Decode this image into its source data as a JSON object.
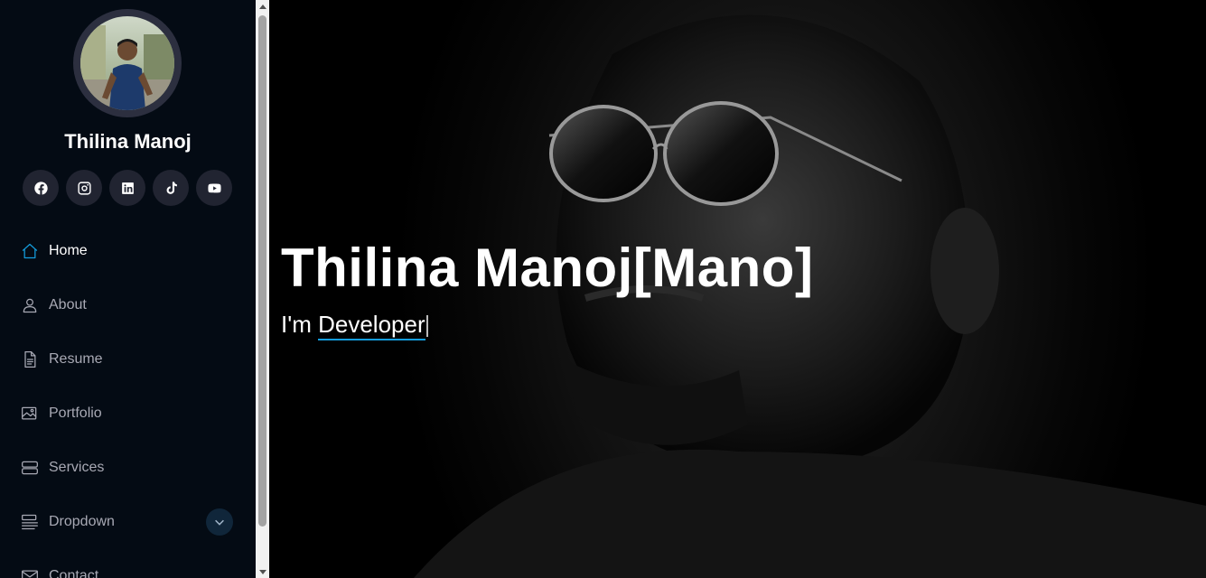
{
  "profile": {
    "name": "Thilina Manoj"
  },
  "socials": [
    "facebook-icon",
    "instagram-icon",
    "linkedin-icon",
    "tiktok-icon",
    "youtube-icon"
  ],
  "nav": {
    "items": [
      {
        "label": "Home",
        "icon": "house-icon",
        "active": true
      },
      {
        "label": "About",
        "icon": "person-icon"
      },
      {
        "label": "Resume",
        "icon": "file-text-icon"
      },
      {
        "label": "Portfolio",
        "icon": "images-icon"
      },
      {
        "label": "Services",
        "icon": "server-icon"
      },
      {
        "label": "Dropdown",
        "icon": "menu-button-icon",
        "has_submenu": true
      },
      {
        "label": "Contact",
        "icon": "envelope-icon"
      }
    ]
  },
  "hero": {
    "title": "Thilina Manoj[Mano]",
    "sub_prefix": "I'm",
    "typed_text": "Developer"
  },
  "colors": {
    "sidebar_bg": "#040b14",
    "accent": "#149ddd",
    "nav_text": "#a8a9b4"
  }
}
